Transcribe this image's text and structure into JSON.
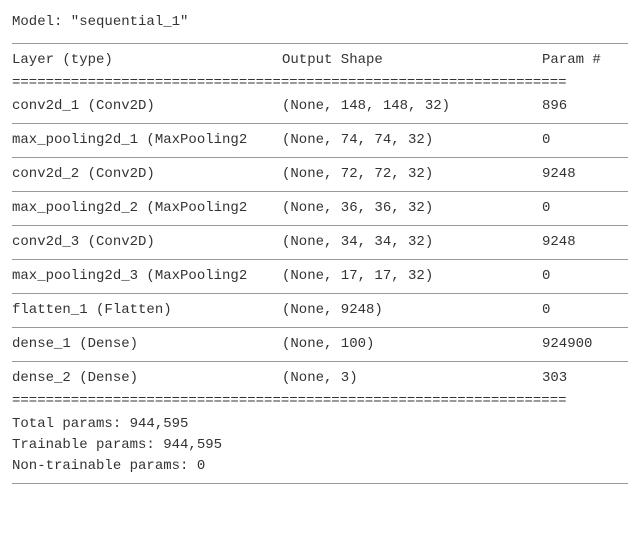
{
  "model_title": "Model: \"sequential_1\"",
  "header": {
    "layer": "Layer (type)",
    "shape": "Output Shape",
    "param": "Param #"
  },
  "equals_line": "==================================================================",
  "layers": [
    {
      "layer": "conv2d_1 (Conv2D)",
      "shape": "(None, 148, 148, 32)",
      "param": "896"
    },
    {
      "layer": "max_pooling2d_1 (MaxPooling2",
      "shape": "(None, 74, 74, 32)",
      "param": "0"
    },
    {
      "layer": "conv2d_2 (Conv2D)",
      "shape": "(None, 72, 72, 32)",
      "param": "9248"
    },
    {
      "layer": "max_pooling2d_2 (MaxPooling2",
      "shape": "(None, 36, 36, 32)",
      "param": "0"
    },
    {
      "layer": "conv2d_3 (Conv2D)",
      "shape": "(None, 34, 34, 32)",
      "param": "9248"
    },
    {
      "layer": "max_pooling2d_3 (MaxPooling2",
      "shape": "(None, 17, 17, 32)",
      "param": "0"
    },
    {
      "layer": "flatten_1 (Flatten)",
      "shape": "(None, 9248)",
      "param": "0"
    },
    {
      "layer": "dense_1 (Dense)",
      "shape": "(None, 100)",
      "param": "924900"
    },
    {
      "layer": "dense_2 (Dense)",
      "shape": "(None, 3)",
      "param": "303"
    }
  ],
  "summary": {
    "total": "Total params: 944,595",
    "trainable": "Trainable params: 944,595",
    "non_trainable": "Non-trainable params: 0"
  },
  "chart_data": {
    "type": "table",
    "title": "Model: \"sequential_1\"",
    "columns": [
      "Layer (type)",
      "Output Shape",
      "Param #"
    ],
    "rows": [
      [
        "conv2d_1 (Conv2D)",
        "(None, 148, 148, 32)",
        896
      ],
      [
        "max_pooling2d_1 (MaxPooling2",
        "(None, 74, 74, 32)",
        0
      ],
      [
        "conv2d_2 (Conv2D)",
        "(None, 72, 72, 32)",
        9248
      ],
      [
        "max_pooling2d_2 (MaxPooling2",
        "(None, 36, 36, 32)",
        0
      ],
      [
        "conv2d_3 (Conv2D)",
        "(None, 34, 34, 32)",
        9248
      ],
      [
        "max_pooling2d_3 (MaxPooling2",
        "(None, 17, 17, 32)",
        0
      ],
      [
        "flatten_1 (Flatten)",
        "(None, 9248)",
        0
      ],
      [
        "dense_1 (Dense)",
        "(None, 100)",
        924900
      ],
      [
        "dense_2 (Dense)",
        "(None, 3)",
        303
      ]
    ],
    "totals": {
      "total_params": 944595,
      "trainable_params": 944595,
      "non_trainable_params": 0
    }
  }
}
